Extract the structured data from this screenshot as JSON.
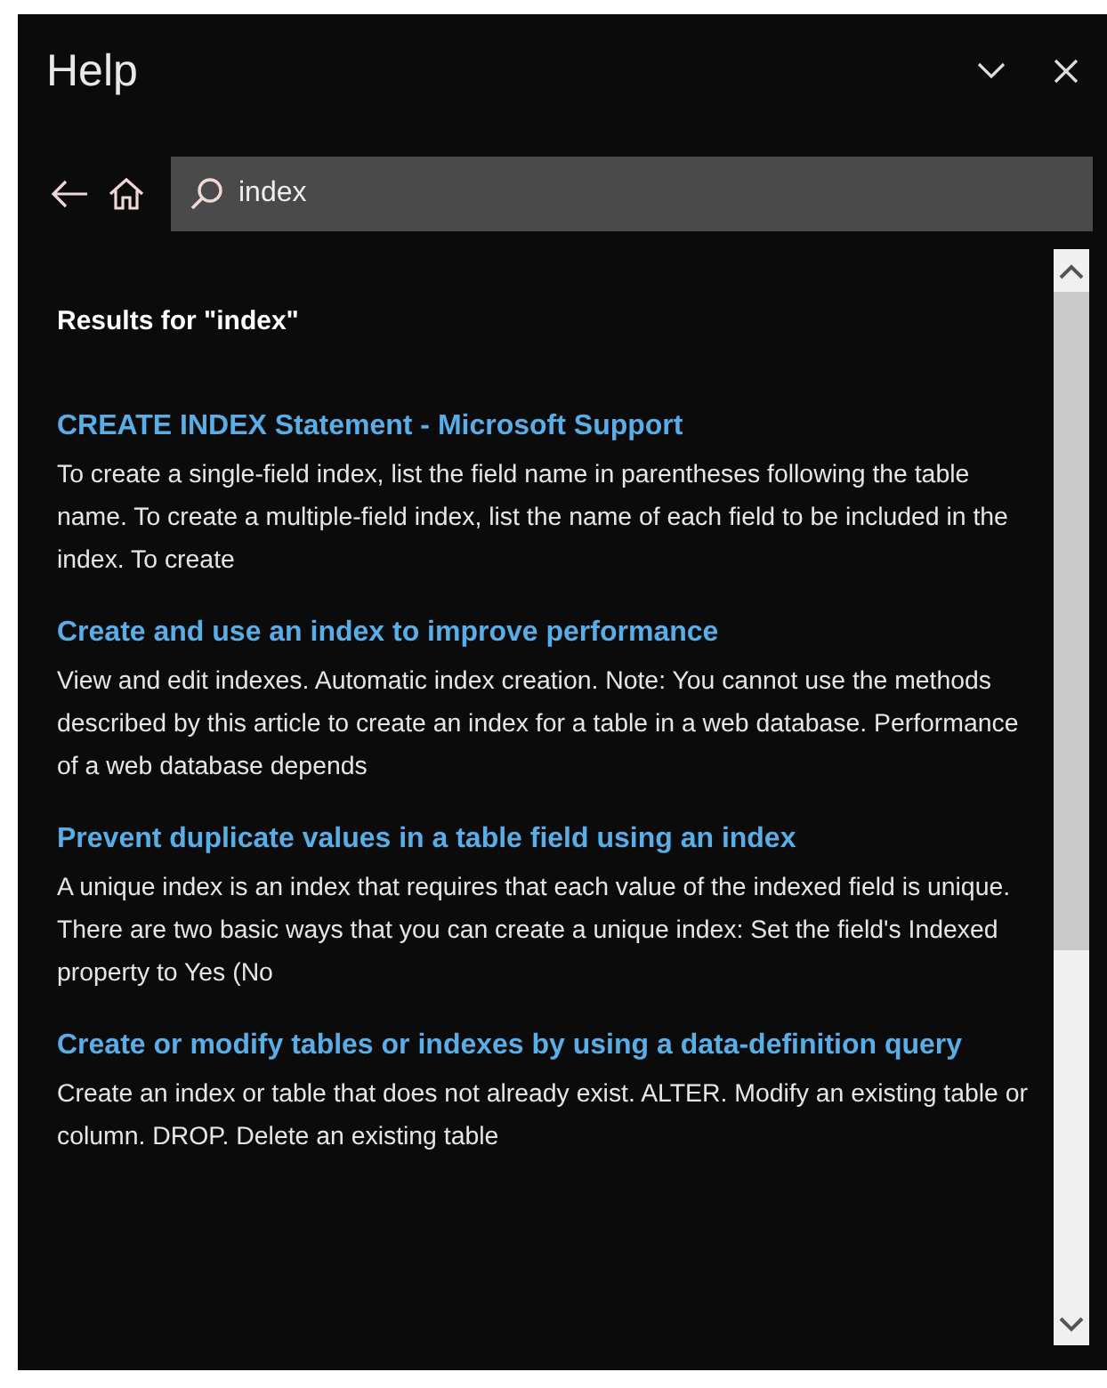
{
  "window": {
    "title": "Help"
  },
  "search": {
    "value": "index"
  },
  "results_heading": "Results for \"index\"",
  "results": [
    {
      "title": "CREATE INDEX Statement - Microsoft Support",
      "snippet": "To create a single-field index, list the field name in parentheses following the table name. To create a multiple-field index, list the name of each field to be included in the index. To create"
    },
    {
      "title": "Create and use an index to improve performance",
      "snippet": "View and edit indexes. Automatic index creation. Note: You cannot use the methods described by this article to create an index for a table in a web database. Performance of a web database depends"
    },
    {
      "title": "Prevent duplicate values in a table field using an index",
      "snippet": "A unique index is an index that requires that each value of the indexed field is unique. There are two basic ways that you can create a unique index: Set the field's Indexed property to Yes (No"
    },
    {
      "title": "Create or modify tables or indexes by using a data-definition query",
      "snippet": "Create an index or table that does not already exist. ALTER. Modify an existing table or column. DROP. Delete an existing table"
    }
  ]
}
